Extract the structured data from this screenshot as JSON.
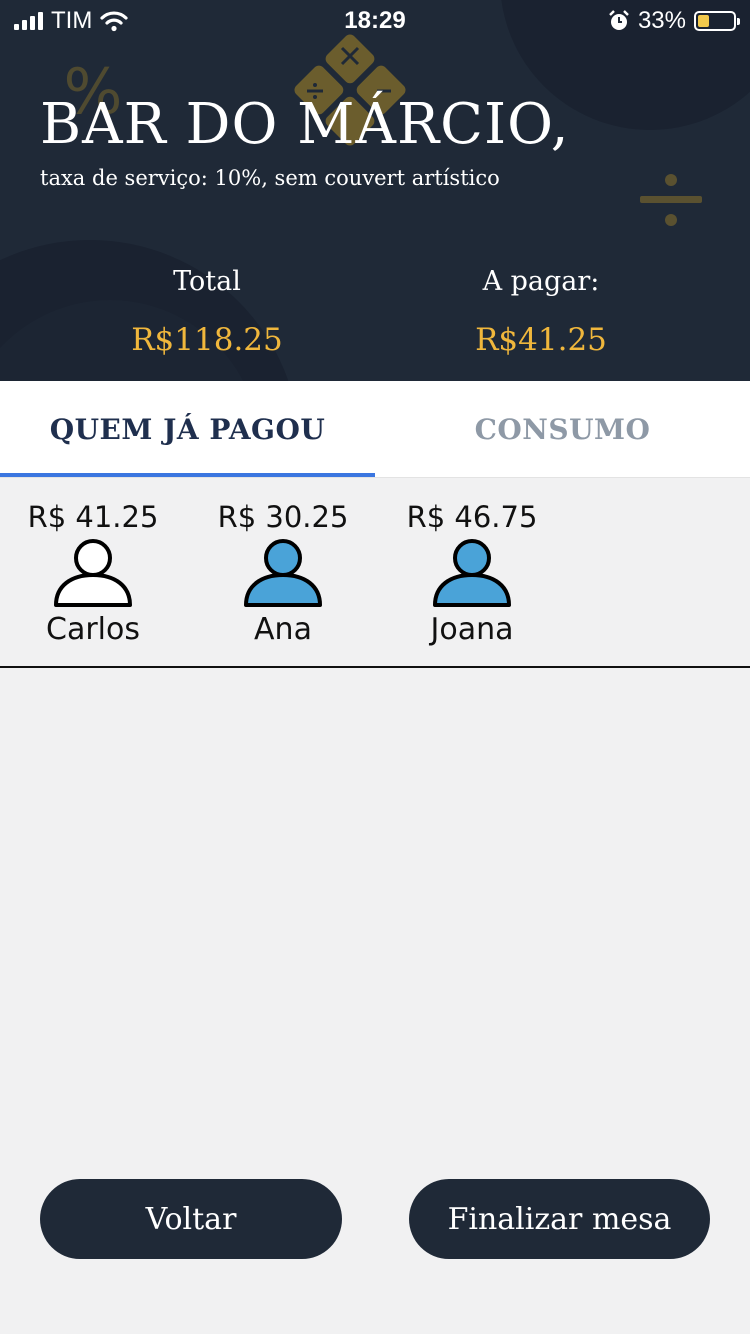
{
  "status_bar": {
    "carrier": "TIM",
    "time": "18:29",
    "battery_percent": "33%",
    "battery_level": 0.33,
    "icons": [
      "signal-icon",
      "wifi-icon",
      "alarm-icon",
      "battery-icon"
    ]
  },
  "header": {
    "title": "BAR DO MÁRCIO,",
    "subtitle": "taxa de serviço: 10%, sem couvert artístico",
    "summary": [
      {
        "label": "Total",
        "value": "R$118.25"
      },
      {
        "label": "A pagar:",
        "value": "R$41.25"
      }
    ]
  },
  "tabs": [
    {
      "label": "QUEM JÁ PAGOU",
      "active": true
    },
    {
      "label": "CONSUMO",
      "active": false
    }
  ],
  "people": [
    {
      "amount": "R$ 41.25",
      "name": "Carlos",
      "paid": false
    },
    {
      "amount": "R$ 30.25",
      "name": "Ana",
      "paid": true
    },
    {
      "amount": "R$ 46.75",
      "name": "Joana",
      "paid": true
    }
  ],
  "buttons": {
    "back": "Voltar",
    "finish": "Finalizar mesa"
  },
  "colors": {
    "header_bg": "#1f2937",
    "accent_gold": "#f0b73c",
    "tab_active": "#1f2f4e",
    "tab_underline": "#3b76e0",
    "avatar_paid": "#4aa3d8",
    "avatar_unpaid": "#ffffff"
  }
}
